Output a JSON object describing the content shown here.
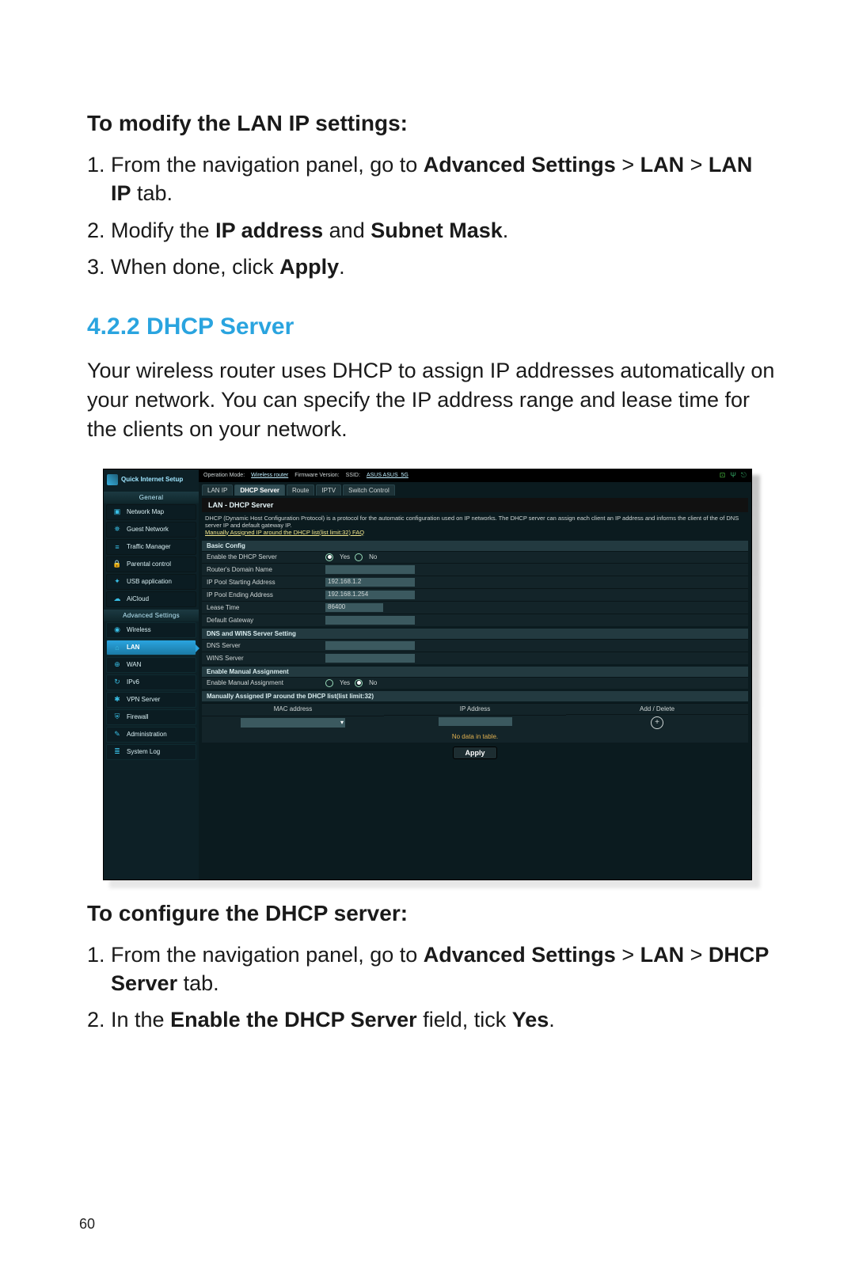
{
  "page_number": "60",
  "sec1_heading": "To modify the LAN IP settings:",
  "sec1_steps": {
    "s1a": "From the navigation panel, go to ",
    "s1b": "Advanced Settings",
    "s1c": " > ",
    "s1d": "LAN",
    "s1e": " > ",
    "s1f": "LAN IP",
    "s1g": " tab.",
    "s2a": "Modify the ",
    "s2b": "IP address",
    "s2c": " and ",
    "s2d": "Subnet Mask",
    "s2e": ".",
    "s3a": "When done, click ",
    "s3b": "Apply",
    "s3c": "."
  },
  "section_number": "4.2.2 DHCP Server",
  "intro": "Your wireless router uses DHCP to assign IP addresses automatically on your network. You can specify the IP address range and lease time for the clients on your network.",
  "shot": {
    "qis": "Quick Internet Setup",
    "topbar": {
      "op_label": "Operation Mode:",
      "op_value": "Wireless router",
      "fw_label": "Firmware Version:",
      "ssid_label": "SSID:",
      "ssid_value": "ASUS  ASUS_5G"
    },
    "sidebar": {
      "general_hdr": "General",
      "adv_hdr": "Advanced Settings",
      "general_items": [
        "Network Map",
        "Guest Network",
        "Traffic Manager",
        "Parental control",
        "USB application",
        "AiCloud"
      ],
      "adv_items": [
        "Wireless",
        "LAN",
        "WAN",
        "IPv6",
        "VPN Server",
        "Firewall",
        "Administration",
        "System Log"
      ]
    },
    "tabs": [
      "LAN IP",
      "DHCP Server",
      "Route",
      "IPTV",
      "Switch Control"
    ],
    "panel_title": "LAN - DHCP Server",
    "desc": "DHCP (Dynamic Host Configuration Protocol) is a protocol for the automatic configuration used on IP networks. The DHCP server can assign each client an IP address and informs the client of the of DNS server IP and default gateway IP.",
    "faq_link": "Manually Assigned IP around the DHCP list(list limit:32) FAQ",
    "basic_hdr": "Basic Config",
    "fields": {
      "enable": "Enable the DHCP Server",
      "yes": "Yes",
      "no": "No",
      "domain": "Router's Domain Name",
      "ip_start": "IP Pool Starting Address",
      "ip_start_v": "192.168.1.2",
      "ip_end": "IP Pool Ending Address",
      "ip_end_v": "192.168.1.254",
      "lease": "Lease Time",
      "lease_v": "86400",
      "gateway": "Default Gateway"
    },
    "dns_hdr": "DNS and WINS Server Setting",
    "dns": "DNS Server",
    "wins": "WINS Server",
    "manual_hdr": "Enable Manual Assignment",
    "manual_label": "Enable Manual Assignment",
    "list_hdr": "Manually Assigned IP around the DHCP list(list limit:32)",
    "cols": {
      "mac": "MAC address",
      "ip": "IP Address",
      "act": "Add / Delete"
    },
    "no_data": "No data in table.",
    "apply": "Apply"
  },
  "sec2_heading": "To configure the DHCP server:",
  "sec2_steps": {
    "s1a": "From the navigation panel, go to ",
    "s1b": "Advanced Settings",
    "s1c": " > ",
    "s1d": "LAN",
    "s1e": " > ",
    "s1f": "DHCP Server",
    "s1g": " tab.",
    "s2a": "In the ",
    "s2b": "Enable the DHCP Server",
    "s2c": " field, tick ",
    "s2d": "Yes",
    "s2e": "."
  }
}
